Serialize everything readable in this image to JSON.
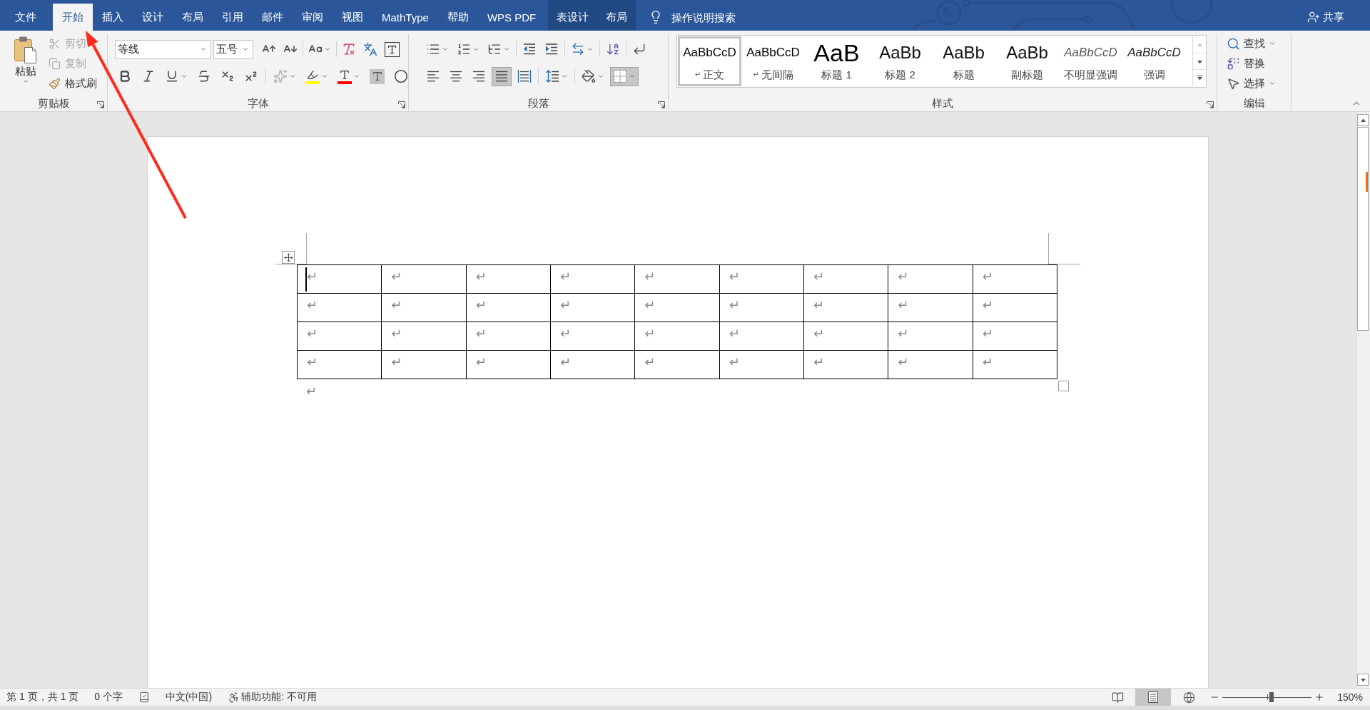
{
  "tabs": [
    {
      "label": "文件",
      "kind": "file",
      "selected": false
    },
    {
      "label": "开始",
      "kind": "tab",
      "selected": true
    },
    {
      "label": "插入",
      "kind": "tab",
      "selected": false
    },
    {
      "label": "设计",
      "kind": "tab",
      "selected": false
    },
    {
      "label": "布局",
      "kind": "tab",
      "selected": false
    },
    {
      "label": "引用",
      "kind": "tab",
      "selected": false
    },
    {
      "label": "邮件",
      "kind": "tab",
      "selected": false
    },
    {
      "label": "审阅",
      "kind": "tab",
      "selected": false
    },
    {
      "label": "视图",
      "kind": "tab",
      "selected": false
    },
    {
      "label": "MathType",
      "kind": "tab",
      "selected": false
    },
    {
      "label": "帮助",
      "kind": "tab",
      "selected": false
    },
    {
      "label": "WPS PDF",
      "kind": "tab",
      "selected": false
    },
    {
      "label": "表设计",
      "kind": "contextual",
      "selected": false
    },
    {
      "label": "布局",
      "kind": "contextual",
      "selected": false
    }
  ],
  "search": {
    "placeholder": "操作说明搜索"
  },
  "share": {
    "label": "共享"
  },
  "ribbon": {
    "clipboard": {
      "title": "剪贴板",
      "launcher": true,
      "paste": {
        "label": "粘贴",
        "dropdown": true
      },
      "actions": [
        {
          "label": "剪切",
          "kind": "cut",
          "disabled": true
        },
        {
          "label": "复制",
          "kind": "copy",
          "disabled": true
        },
        {
          "label": "格式刷",
          "kind": "format-painter",
          "disabled": false
        }
      ]
    },
    "font": {
      "title": "字体",
      "launcher": true,
      "font_name": {
        "value": "等线"
      },
      "font_size": {
        "value": "五号"
      },
      "row_1": [
        [
          {
            "kind": "grow-font",
            "dropdown": false
          },
          {
            "kind": "shrink-font",
            "dropdown": false
          }
        ],
        [
          {
            "kind": "change-case",
            "dropdown": true
          }
        ],
        [
          {
            "kind": "clear-formatting",
            "dropdown": false
          },
          {
            "kind": "phonetic-guide",
            "dropdown": false
          },
          {
            "kind": "character-border",
            "dropdown": false
          }
        ]
      ],
      "row_2": [
        [
          {
            "kind": "bold",
            "dropdown": false
          },
          {
            "kind": "italic",
            "dropdown": false
          },
          {
            "kind": "underline",
            "dropdown": true
          },
          {
            "kind": "strikethrough",
            "dropdown": false
          },
          {
            "kind": "subscript",
            "dropdown": false
          },
          {
            "kind": "superscript",
            "dropdown": false
          }
        ],
        [
          {
            "kind": "text-effects",
            "dropdown": true
          },
          {
            "kind": "highlight",
            "dropdown": true
          },
          {
            "kind": "font-color",
            "dropdown": true
          },
          {
            "kind": "character-shading",
            "dropdown": false
          },
          {
            "kind": "enclose-characters",
            "dropdown": false
          }
        ]
      ]
    },
    "paragraph": {
      "title": "段落",
      "launcher": true,
      "row_1": [
        [
          {
            "kind": "bullets",
            "dropdown": true
          },
          {
            "kind": "numbering",
            "dropdown": true
          },
          {
            "kind": "multilevel",
            "dropdown": true
          }
        ],
        [
          {
            "kind": "decrease-indent",
            "dropdown": false
          },
          {
            "kind": "increase-indent",
            "dropdown": false
          }
        ],
        [
          {
            "kind": "asian-layout",
            "dropdown": true
          }
        ],
        [
          {
            "kind": "sort",
            "dropdown": false
          }
        ],
        [
          {
            "kind": "show-marks",
            "dropdown": false
          }
        ]
      ],
      "row_2": [
        [
          {
            "kind": "align-left",
            "dropdown": false,
            "selected": false
          },
          {
            "kind": "align-center",
            "dropdown": false,
            "selected": false
          },
          {
            "kind": "align-right",
            "dropdown": false,
            "selected": false
          },
          {
            "kind": "justify",
            "dropdown": false,
            "selected": true
          },
          {
            "kind": "distributed",
            "dropdown": false,
            "selected": false
          }
        ],
        [
          {
            "kind": "line-spacing",
            "dropdown": true,
            "selected": false
          }
        ],
        [
          {
            "kind": "shading",
            "dropdown": true,
            "selected": false
          },
          {
            "kind": "borders",
            "dropdown": true,
            "selected": true
          }
        ]
      ]
    },
    "styles": {
      "title": "样式",
      "launcher": true,
      "items": [
        {
          "preview": "AaBbCcD",
          "mark": "↵",
          "name": "正文",
          "kind": "normal",
          "selected": true
        },
        {
          "preview": "AaBbCcD",
          "mark": "↵",
          "name": "无间隔",
          "kind": "no-spacing",
          "selected": false
        },
        {
          "preview": "AaB",
          "name": "标题 1",
          "kind": "heading1",
          "selected": false
        },
        {
          "preview": "AaBb",
          "name": "标题 2",
          "kind": "heading2",
          "selected": false
        },
        {
          "preview": "AaBb",
          "name": "标题",
          "kind": "title",
          "selected": false
        },
        {
          "preview": "AaBb",
          "name": "副标题",
          "kind": "subtitle",
          "selected": false
        },
        {
          "preview": "AaBbCcD",
          "name": "不明显强调",
          "kind": "subtle-emphasis",
          "selected": false
        },
        {
          "preview": "AaBbCcD",
          "name": "强调",
          "kind": "emphasis",
          "selected": false
        }
      ]
    },
    "editing": {
      "title": "编辑",
      "launcher": false,
      "items": [
        {
          "label": "查找",
          "kind": "find",
          "dropdown": true
        },
        {
          "label": "替换",
          "kind": "replace",
          "dropdown": false
        },
        {
          "label": "选择",
          "kind": "select",
          "dropdown": true
        }
      ]
    }
  },
  "document": {
    "table": {
      "rows": [
        {
          "cells": [
            {
              "text": "↵",
              "cursor": true
            },
            {
              "text": "↵",
              "cursor": false
            },
            {
              "text": "↵",
              "cursor": false
            },
            {
              "text": "↵",
              "cursor": false
            },
            {
              "text": "↵",
              "cursor": false
            },
            {
              "text": "↵",
              "cursor": false
            },
            {
              "text": "↵",
              "cursor": false
            },
            {
              "text": "↵",
              "cursor": false
            },
            {
              "text": "↵",
              "cursor": false
            }
          ]
        },
        {
          "cells": [
            {
              "text": "↵",
              "cursor": false
            },
            {
              "text": "↵",
              "cursor": false
            },
            {
              "text": "↵",
              "cursor": false
            },
            {
              "text": "↵",
              "cursor": false
            },
            {
              "text": "↵",
              "cursor": false
            },
            {
              "text": "↵",
              "cursor": false
            },
            {
              "text": "↵",
              "cursor": false
            },
            {
              "text": "↵",
              "cursor": false
            },
            {
              "text": "↵",
              "cursor": false
            }
          ]
        },
        {
          "cells": [
            {
              "text": "↵",
              "cursor": false
            },
            {
              "text": "↵",
              "cursor": false
            },
            {
              "text": "↵",
              "cursor": false
            },
            {
              "text": "↵",
              "cursor": false
            },
            {
              "text": "↵",
              "cursor": false
            },
            {
              "text": "↵",
              "cursor": false
            },
            {
              "text": "↵",
              "cursor": false
            },
            {
              "text": "↵",
              "cursor": false
            },
            {
              "text": "↵",
              "cursor": false
            }
          ]
        },
        {
          "cells": [
            {
              "text": "↵",
              "cursor": false
            },
            {
              "text": "↵",
              "cursor": false
            },
            {
              "text": "↵",
              "cursor": false
            },
            {
              "text": "↵",
              "cursor": false
            },
            {
              "text": "↵",
              "cursor": false
            },
            {
              "text": "↵",
              "cursor": false
            },
            {
              "text": "↵",
              "cursor": false
            },
            {
              "text": "↵",
              "cursor": false
            },
            {
              "text": "↵",
              "cursor": false
            }
          ]
        }
      ]
    },
    "paragraph_mark": "↵"
  },
  "status_bar": {
    "items": [
      {
        "kind": "pages",
        "label": "第 1 页，共 1 页"
      },
      {
        "kind": "words",
        "label": "0 个字"
      },
      {
        "kind": "proofing"
      },
      {
        "kind": "language",
        "label": "中文(中国)"
      },
      {
        "kind": "accessibility",
        "label": "辅助功能: 不可用"
      }
    ],
    "views": [
      {
        "kind": "read",
        "selected": false
      },
      {
        "kind": "print",
        "selected": true
      },
      {
        "kind": "web",
        "selected": false
      }
    ],
    "zoom": {
      "level": 0.55,
      "reading": "150%"
    }
  }
}
